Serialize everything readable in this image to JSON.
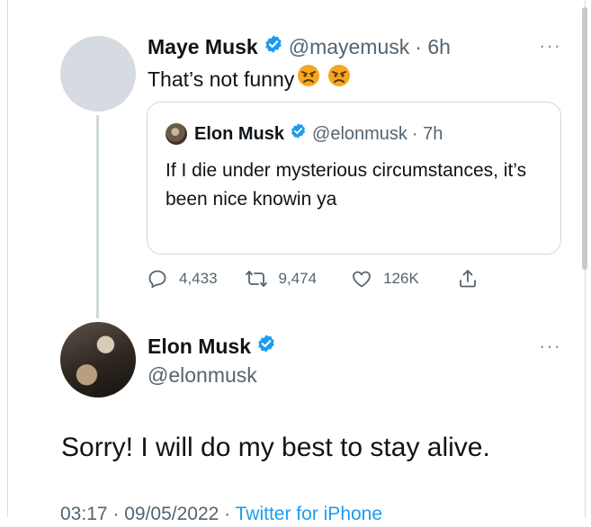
{
  "reply_tweet": {
    "name": "Maye Musk",
    "handle": "@mayemusk",
    "time": "· 6h",
    "text": "That’s not funny",
    "emoji": [
      "😠",
      "😠"
    ]
  },
  "quoted_tweet": {
    "name": "Elon Musk",
    "handle": "@elonmusk",
    "time": "· 7h",
    "text": "If I die under mysterious circumstances, it’s been nice knowin ya"
  },
  "actions": {
    "replies": "4,433",
    "retweets": "9,474",
    "likes": "126K"
  },
  "main_tweet": {
    "name": "Elon Musk",
    "handle": "@elonmusk",
    "text": "Sorry! I will do my best to stay alive.",
    "timestamp": "03:17 · 09/05/2022 ·",
    "source": "Twitter for iPhone"
  },
  "more_icon": "···",
  "colors": {
    "verified": "#1d9bf0",
    "link": "#1d9bf0",
    "secondary_text": "#536471",
    "border": "#cfd9de"
  },
  "icons": [
    "verified-badge-icon",
    "more-icon",
    "reply-icon",
    "retweet-icon",
    "like-icon",
    "share-icon",
    "angry-face-emoji"
  ]
}
